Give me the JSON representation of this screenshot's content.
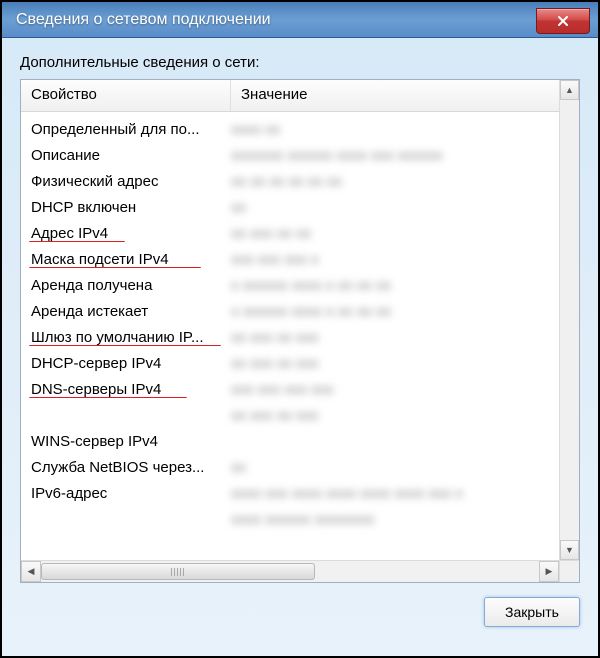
{
  "window": {
    "title": "Сведения о сетевом подключении"
  },
  "subtitle": "Дополнительные сведения о сети:",
  "columns": {
    "property": "Свойство",
    "value": "Значение"
  },
  "rows": [
    {
      "prop": "Определенный для по...",
      "val": "xxxx xx"
    },
    {
      "prop": "Описание",
      "val": "xxxxxxx xxxxxx xxxx xxx xxxxxx"
    },
    {
      "prop": "Физический адрес",
      "val": "xx xx xx xx xx xx"
    },
    {
      "prop": "DHCP включен",
      "val": "xx"
    },
    {
      "prop": "Адрес IPv4",
      "val": "xx xxx xx xx"
    },
    {
      "prop": "Маска подсети IPv4",
      "val": "xxx xxx xxx x"
    },
    {
      "prop": "Аренда получена",
      "val": "x xxxxxx xxxx x  xx xx xx"
    },
    {
      "prop": "Аренда истекает",
      "val": "x xxxxxx xxxx x  xx xx xx"
    },
    {
      "prop": "Шлюз по умолчанию IP...",
      "val": "xx xxx xx xxx"
    },
    {
      "prop": "DHCP-сервер IPv4",
      "val": "xx xxx xx xxx"
    },
    {
      "prop": "DNS-серверы IPv4",
      "val": "xxx xxx xxx xxx"
    },
    {
      "prop": "",
      "val": "xx xxx xx xxx"
    },
    {
      "prop": "WINS-сервер IPv4",
      "val": ""
    },
    {
      "prop": "Служба NetBIOS через...",
      "val": "xx"
    },
    {
      "prop": "IPv6-адрес",
      "val": "xxxx xxx xxxx xxxx xxxx xxxx xxx x"
    },
    {
      "prop": "",
      "val": "xxxx xxxxxx xxxxxxxx"
    }
  ],
  "buttons": {
    "close": "Закрыть"
  }
}
